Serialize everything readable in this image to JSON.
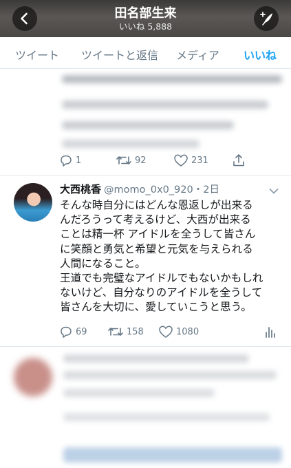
{
  "header": {
    "title": "田名部生来",
    "subtitle": "いいね 5,888"
  },
  "tabs": [
    {
      "label": "ツイート",
      "active": false
    },
    {
      "label": "ツイートと返信",
      "active": false
    },
    {
      "label": "メディア",
      "active": false
    },
    {
      "label": "いいね",
      "active": true
    }
  ],
  "prev_tweet": {
    "replies": "1",
    "retweets": "92",
    "likes": "231"
  },
  "tweet": {
    "display_name": "大西桃香",
    "handle": "@momo_0x0_920",
    "time": "・2日",
    "lines": [
      "そんな時自分にはどんな恩返しが出来る",
      "んだろうって考えるけど、大西が出来る",
      "ことは精一杯 アイドルを全うして皆さん",
      "に笑顔と勇気と希望と元気を与えられる",
      "人間になること。",
      "王道でも完璧なアイドルでもないかもしれ",
      "ないけど、自分なりのアイドルを全うして",
      "皆さんを大切に、愛していこうと思う。"
    ],
    "replies": "69",
    "retweets": "158",
    "likes": "1080"
  },
  "colors": {
    "accent": "#1da1f2",
    "muted": "#657786",
    "text": "#14171a"
  },
  "icons": [
    "back-arrow-icon",
    "compose-icon",
    "reply-icon",
    "retweet-icon",
    "like-icon",
    "share-icon",
    "chevron-down-icon",
    "analytics-icon"
  ]
}
